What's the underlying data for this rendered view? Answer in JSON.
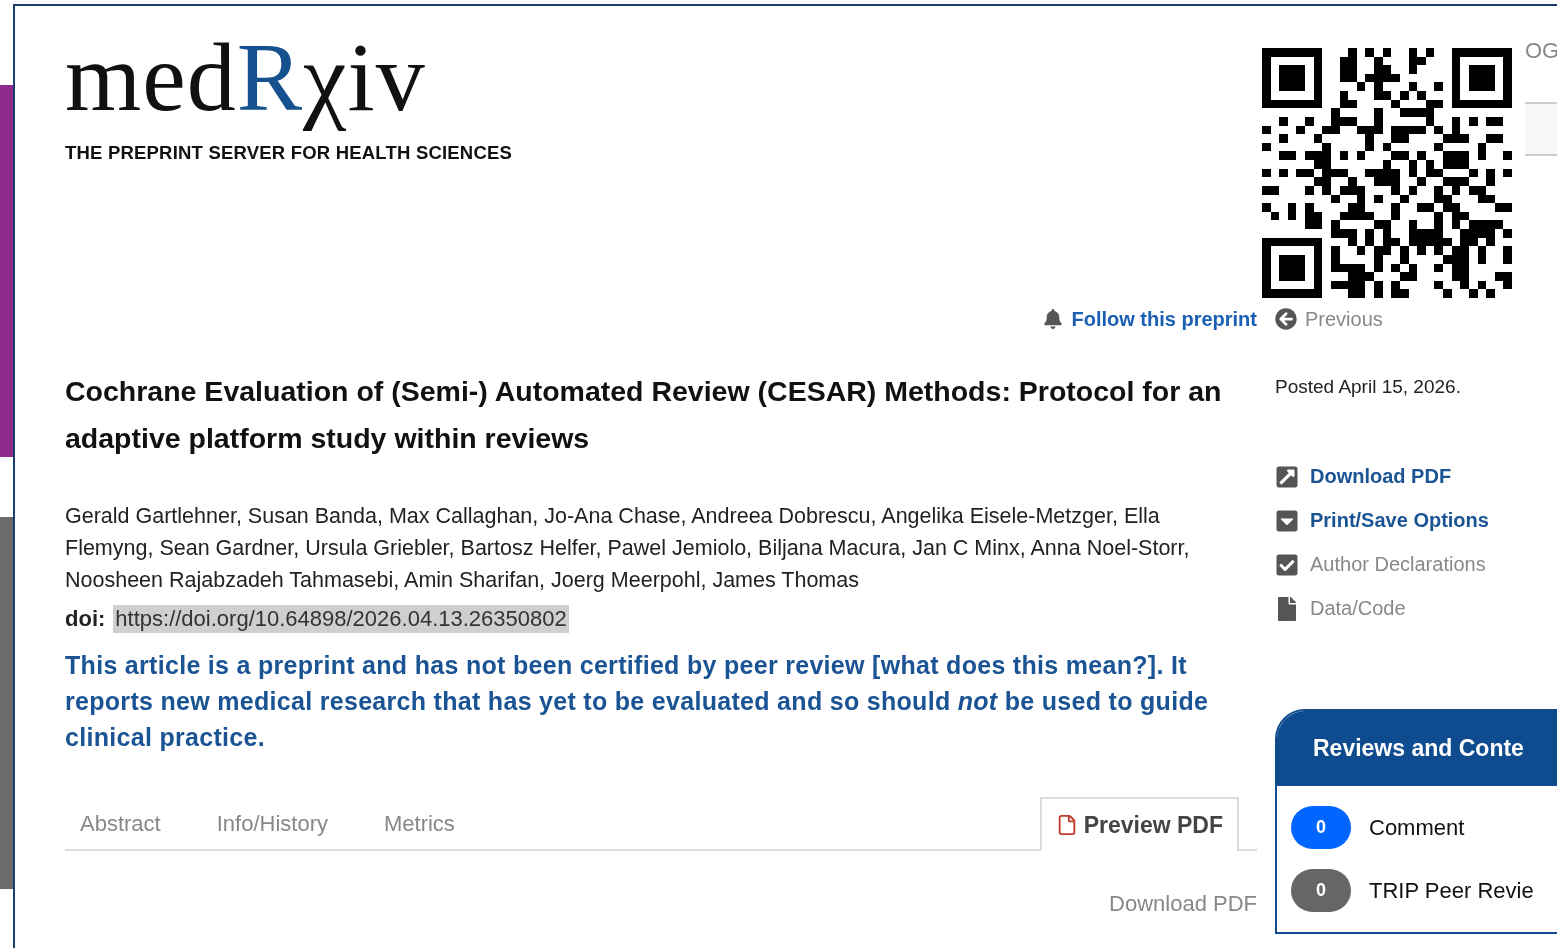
{
  "slide_behind": {
    "blocks": [
      {
        "color": "#8e2c8e"
      },
      {
        "color": "#6b6b6b"
      }
    ]
  },
  "header": {
    "logo": {
      "before": "med",
      "accent": "R",
      "after": "χiv"
    },
    "tagline": "THE PREPRINT SERVER FOR HEALTH SCIENCES",
    "account_link": "OG"
  },
  "follow_link": "Follow this preprint",
  "previous_link": "Previous",
  "article": {
    "title": "Cochrane Evaluation of (Semi-) Automated Review (CESAR) Methods: Protocol for an adaptive platform study within reviews",
    "authors": "Gerald Gartlehner, Susan Banda, Max Callaghan, Jo-Ana Chase, Andreea Dobrescu, Angelika Eisele-Metzger, Ella Flemyng, Sean Gardner, Ursula Griebler, Bartosz Helfer, Pawel Jemiolo, Biljana Macura, Jan C Minx, Anna Noel-Storr, Noosheen Rajabzadeh Tahmasebi, Amin Sharifan, Joerg Meerpohl, James Thomas",
    "doi_label": "doi:",
    "doi": "https://doi.org/10.64898/2026.04.13.26350802",
    "notice": "This article is a preprint and has not been certified by peer review **[what does this mean?]**. It reports new medical research that has yet to be evaluated and so should *not* be used to guide clinical practice."
  },
  "tabs": [
    {
      "label": "Abstract",
      "selected": false
    },
    {
      "label": "Info/History",
      "selected": false
    },
    {
      "label": "Metrics",
      "selected": false
    },
    {
      "label": "Preview PDF",
      "selected": true
    }
  ],
  "download_pdf_text": "Download PDF",
  "sidebar": {
    "posted": "Posted April 15, 2026.",
    "links": [
      {
        "label": "Download PDF",
        "kind": "download",
        "emphasis": true
      },
      {
        "label": "Print/Save Options",
        "kind": "print",
        "emphasis": true
      },
      {
        "label": "Author Declarations",
        "kind": "declarations",
        "emphasis": false
      },
      {
        "label": "Data/Code",
        "kind": "data",
        "emphasis": false
      }
    ],
    "reviews": {
      "title": "Reviews and Conte",
      "items": [
        {
          "count": "0",
          "label": "Comment",
          "color": "#0066ff"
        },
        {
          "count": "0",
          "label": "TRIP Peer Revie",
          "color": "#666666"
        }
      ]
    }
  }
}
